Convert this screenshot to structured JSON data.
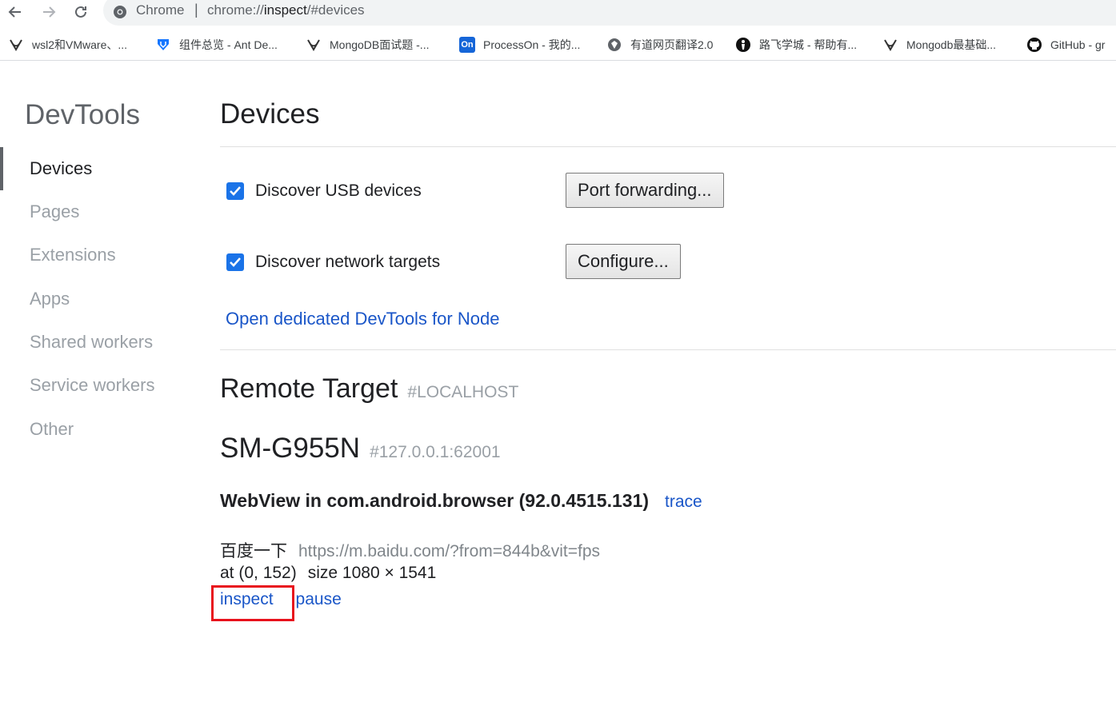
{
  "browser": {
    "omnibox": {
      "site_chip": "Chrome",
      "separator": "|",
      "url_scheme": "chrome://",
      "url_host": "inspect",
      "url_path": "/#devices"
    },
    "bookmarks": [
      {
        "label": "wsl2和VMware、...",
        "icon": "yuque-icon"
      },
      {
        "label": "组件总览 - Ant De...",
        "icon": "ant-design-icon"
      },
      {
        "label": "MongoDB面试题 -...",
        "icon": "yuque-icon"
      },
      {
        "label": "ProcessOn - 我的...",
        "icon": "processon-icon",
        "icon_text": "On"
      },
      {
        "label": "有道网页翻译2.0",
        "icon": "globe-icon"
      },
      {
        "label": "路飞学城 - 帮助有...",
        "icon": "luffy-icon"
      },
      {
        "label": "Mongodb最基础...",
        "icon": "yuque-icon"
      },
      {
        "label": "GitHub - gr",
        "icon": "github-icon"
      }
    ]
  },
  "sidebar": {
    "title": "DevTools",
    "items": [
      {
        "label": "Devices",
        "active": true
      },
      {
        "label": "Pages",
        "active": false
      },
      {
        "label": "Extensions",
        "active": false
      },
      {
        "label": "Apps",
        "active": false
      },
      {
        "label": "Shared workers",
        "active": false
      },
      {
        "label": "Service workers",
        "active": false
      },
      {
        "label": "Other",
        "active": false
      }
    ]
  },
  "main": {
    "title": "Devices",
    "discover_usb": {
      "label": "Discover USB devices",
      "checked": true
    },
    "port_forwarding_button": "Port forwarding...",
    "discover_network": {
      "label": "Discover network targets",
      "checked": true
    },
    "configure_button": "Configure...",
    "node_link": "Open dedicated DevTools for Node",
    "remote_target": {
      "title": "Remote Target",
      "subtitle": "#LOCALHOST"
    },
    "device": {
      "name": "SM-G955N",
      "address": "#127.0.0.1:62001"
    },
    "webview": {
      "title": "WebView in com.android.browser (92.0.4515.131)",
      "trace_link": "trace",
      "page": {
        "title": "百度一下",
        "url": "https://m.baidu.com/?from=844b&vit=fps",
        "position": "at (0, 152)",
        "size": "size 1080 × 1541"
      },
      "inspect_link": "inspect",
      "pause_link": "pause"
    }
  },
  "colors": {
    "link": "#1a56c8",
    "checkbox": "#1a73e8",
    "highlight": "#e8121c",
    "muted": "#9aa0a6"
  }
}
